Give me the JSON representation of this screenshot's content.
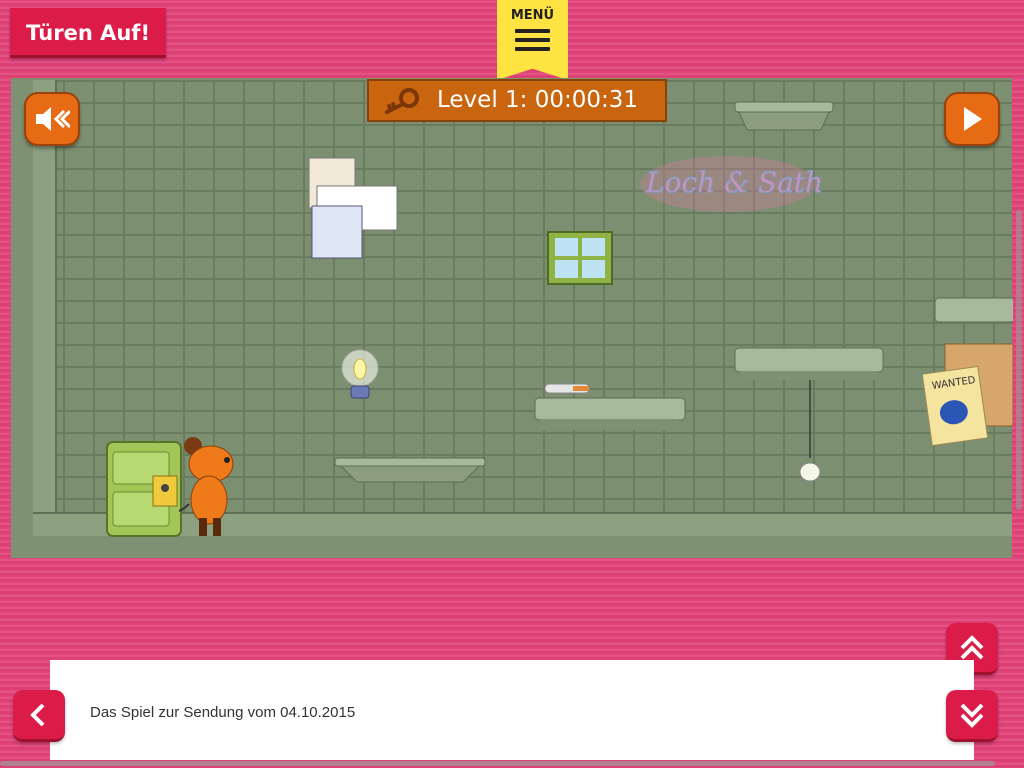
{
  "header": {
    "title": "Türen Auf!",
    "menu_label": "MENÜ"
  },
  "hud": {
    "timer_text": "Level 1: 00:00:31"
  },
  "caption": {
    "text": "Das Spiel zur Sendung vom 04.10.2015"
  },
  "scene": {
    "graffiti_text": "Loch & Sath",
    "wanted_text": "WANTED"
  },
  "colors": {
    "brand_pink": "#dc1c48",
    "menu_yellow": "#ffe342",
    "hud_orange": "#c9650e",
    "wall_green": "#7c8f70"
  },
  "icons": {
    "sound": "speaker-muted-icon",
    "play": "play-icon",
    "back": "chevron-left-icon",
    "up": "double-chevron-up-icon",
    "down": "double-chevron-down-icon",
    "key": "key-icon",
    "menu": "hamburger-icon"
  }
}
